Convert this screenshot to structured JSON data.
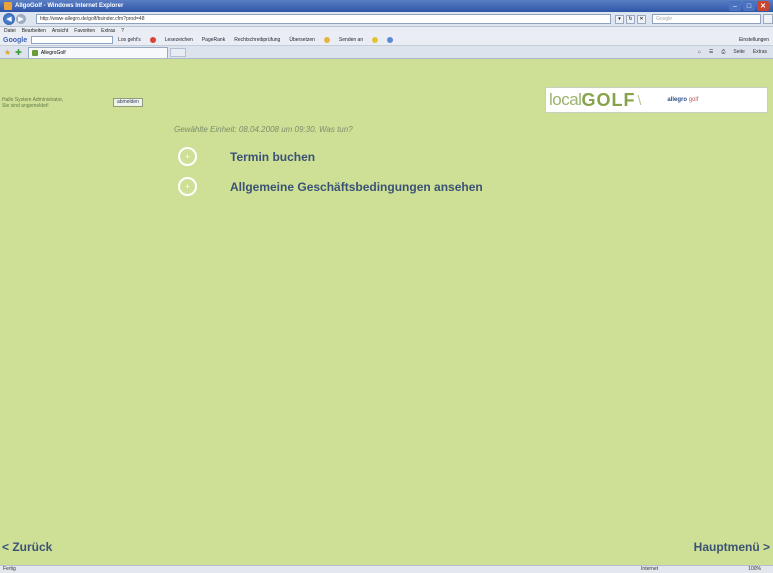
{
  "window": {
    "title": "AllgoGolf - Windows Internet Explorer"
  },
  "address": {
    "url": "http://www-allegro.de/golf/bsinder.cfm?prod=48",
    "search_placeholder": "Google"
  },
  "menu": [
    "Datei",
    "Bearbeiten",
    "Ansicht",
    "Favoriten",
    "Extras",
    "?"
  ],
  "google_toolbar": {
    "logo": "Google",
    "items": [
      "Los geht's",
      "Lesezeichen",
      "PageRank",
      "Rechtschreibprüfung",
      "Übersetzen",
      "Senden an"
    ],
    "settings": "Einstellungen"
  },
  "tab": {
    "label": "AllegroGolf"
  },
  "tab_tools": [
    "Seite",
    "Extras"
  ],
  "page": {
    "login_line1": "Hallo System Administrator,",
    "login_line2": "Sie sind angemeldet!",
    "logout_label": "abmelden",
    "logo_local": "local",
    "logo_golf": "GOLF",
    "logo_partner": "allegro",
    "logo_partner_sub": "golf",
    "subtitle": "Gewählte Einheit: 08.04.2008 um 09:30. Was tun?",
    "options": [
      {
        "label": "Termin buchen"
      },
      {
        "label": "Allgemeine Geschäftsbedingungen ansehen"
      }
    ],
    "back_label": "< Zurück",
    "main_label": "Hauptmenü >"
  },
  "status": {
    "left": "Fertig",
    "zone": "Internet",
    "zoom": "100%"
  }
}
